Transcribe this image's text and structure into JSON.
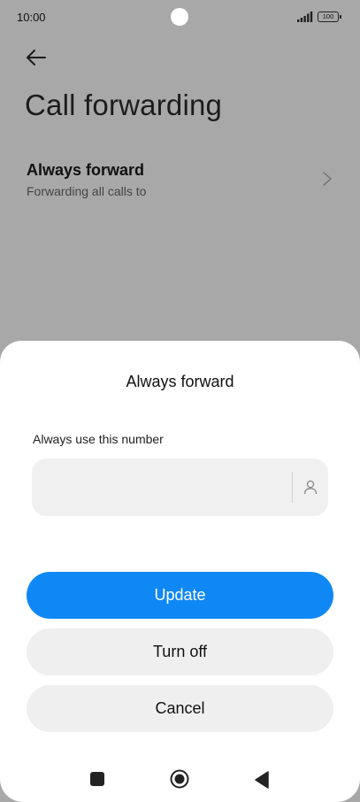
{
  "status_bar": {
    "time": "10:00",
    "battery": "100"
  },
  "header": {
    "back_icon": "arrow-left-icon",
    "title": "Call forwarding"
  },
  "settings_row": {
    "title": "Always forward",
    "subtitle": "Forwarding all calls to",
    "chevron_icon": "chevron-right-icon"
  },
  "sheet": {
    "title": "Always forward",
    "field_label": "Always use this number",
    "input_value": "",
    "contact_icon": "person-icon",
    "update_label": "Update",
    "turn_off_label": "Turn off",
    "cancel_label": "Cancel"
  },
  "colors": {
    "accent": "#0f88f5",
    "scrim": "#a8a8a8",
    "button_secondary": "#efefef"
  },
  "nav_bar": {
    "icons": [
      "square-recent-icon",
      "circle-home-icon",
      "triangle-back-icon"
    ]
  }
}
